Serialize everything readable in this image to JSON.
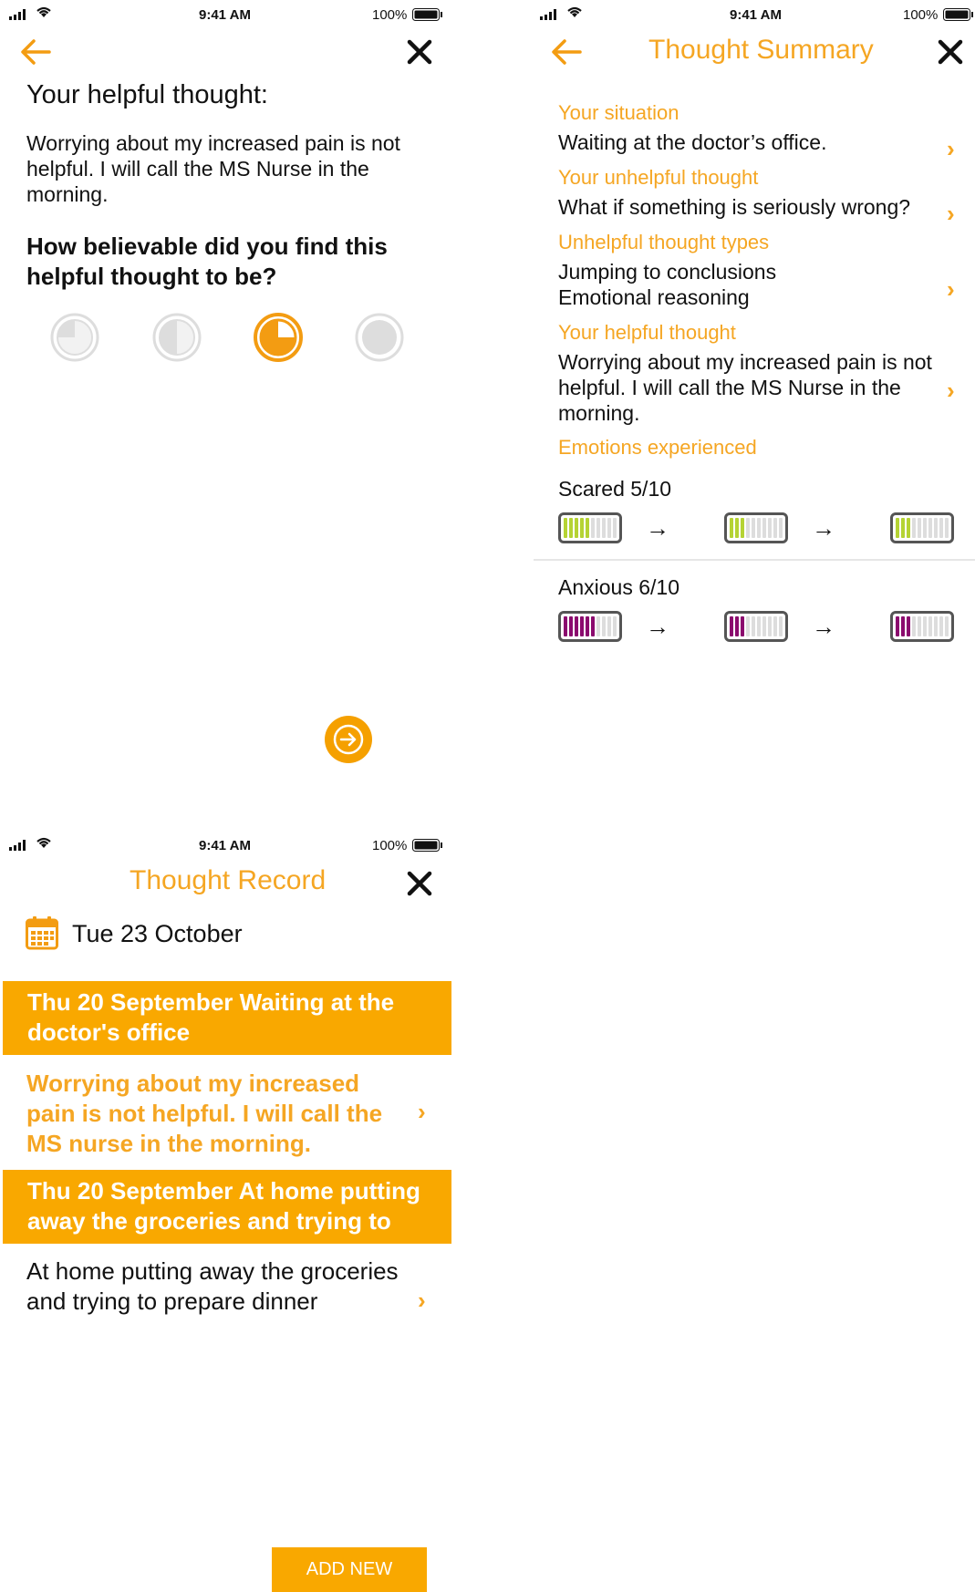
{
  "screen1": {
    "status": {
      "time": "9:41 AM",
      "battery": "100%"
    },
    "heading": "Your helpful thought:",
    "thought": "Worrying about my increased pain is not helpful. I will call the MS Nurse in the morning.",
    "question": "How believable did you find this helpful thought to be?",
    "rating_options": [
      {
        "icon": "quarter-pie-icon",
        "level": 0.25,
        "selected": false
      },
      {
        "icon": "half-pie-icon",
        "level": 0.5,
        "selected": false
      },
      {
        "icon": "three-quarter-pie-icon",
        "level": 0.75,
        "selected": true
      },
      {
        "icon": "full-pie-icon",
        "level": 1.0,
        "selected": false
      }
    ],
    "next_icon": "arrow-right-icon"
  },
  "screen2": {
    "status": {
      "time": "9:41 AM",
      "battery": "100%"
    },
    "title": "Thought Summary",
    "situation_label": "Your situation",
    "situation": "Waiting at the doctor’s office.",
    "unhelpful_label": "Your unhelpful thought",
    "unhelpful": "What if something is seriously wrong?",
    "types_label": "Unhelpful thought types",
    "types": [
      "Jumping to conclusions",
      "Emotional reasoning"
    ],
    "helpful_label": "Your helpful thought",
    "helpful": "Worrying about my increased pain is not helpful. I will call the MS Nurse in the morning.",
    "emotions_label": "Emotions experienced",
    "emotions": [
      {
        "name": "Scared 5/10",
        "color": "#b5d334",
        "levels": [
          0.5,
          0.3,
          0.3
        ]
      },
      {
        "name": "Anxious 6/10",
        "color": "#8b0a6e",
        "levels": [
          0.6,
          0.3,
          0.3
        ]
      }
    ]
  },
  "screen3": {
    "status": {
      "time": "9:41 AM",
      "battery": "100%"
    },
    "title": "Thought Record",
    "date": "Tue 23 October",
    "records": [
      {
        "header": "Thu 20 September Waiting at the doctor's office",
        "body": "Worrying about my increased pain is not helpful. I will call the MS nurse in the morning.",
        "body_color": "#f5a623"
      },
      {
        "header": "Thu 20 September At home putting away the groceries and trying to p...",
        "body": "At home putting away the groceries and trying to prepare dinner",
        "body_color": "#111111"
      }
    ],
    "add_button": "ADD NEW"
  },
  "colors": {
    "accent": "#f5a623",
    "banner": "#f9a800"
  }
}
